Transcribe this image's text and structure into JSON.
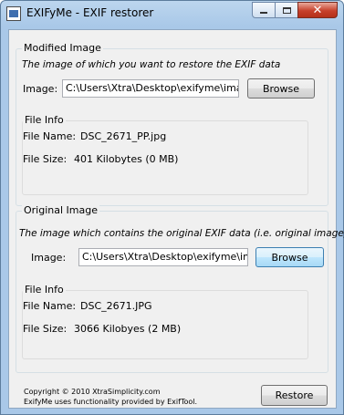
{
  "window": {
    "title": "EXIFyMe - EXIF restorer",
    "controls": {
      "minimize": "minimize",
      "maximize": "maximize",
      "close": "close"
    }
  },
  "modified": {
    "group_title": "Modified Image",
    "description": "The image of which you want to restore the EXIF data",
    "image_label": "Image:",
    "image_path": "C:\\Users\\Xtra\\Desktop\\exifyme\\ima",
    "browse_label": "Browse",
    "file_info": {
      "title": "File Info",
      "name_label": "File Name:",
      "name_value": "DSC_2671_PP.jpg",
      "size_label": "File Size:",
      "size_value": "401 Kilobytes (0 MB)"
    }
  },
  "original": {
    "group_title": "Original Image",
    "description": "The image which contains the original EXIF data (i.e. original image)",
    "image_label": "Image:",
    "image_path": "C:\\Users\\Xtra\\Desktop\\exifyme\\ima",
    "browse_label": "Browse",
    "file_info": {
      "title": "File Info",
      "name_label": "File Name:",
      "name_value": "DSC_2671.JPG",
      "size_label": "File Size:",
      "size_value": "3066 Kilobyes (2 MB)"
    }
  },
  "footer": {
    "copyright": "Copyright © 2010 XtraSimplicity.com",
    "credit": "ExifyMe uses functionality provided by ExifTool.",
    "restore_label": "Restore"
  }
}
